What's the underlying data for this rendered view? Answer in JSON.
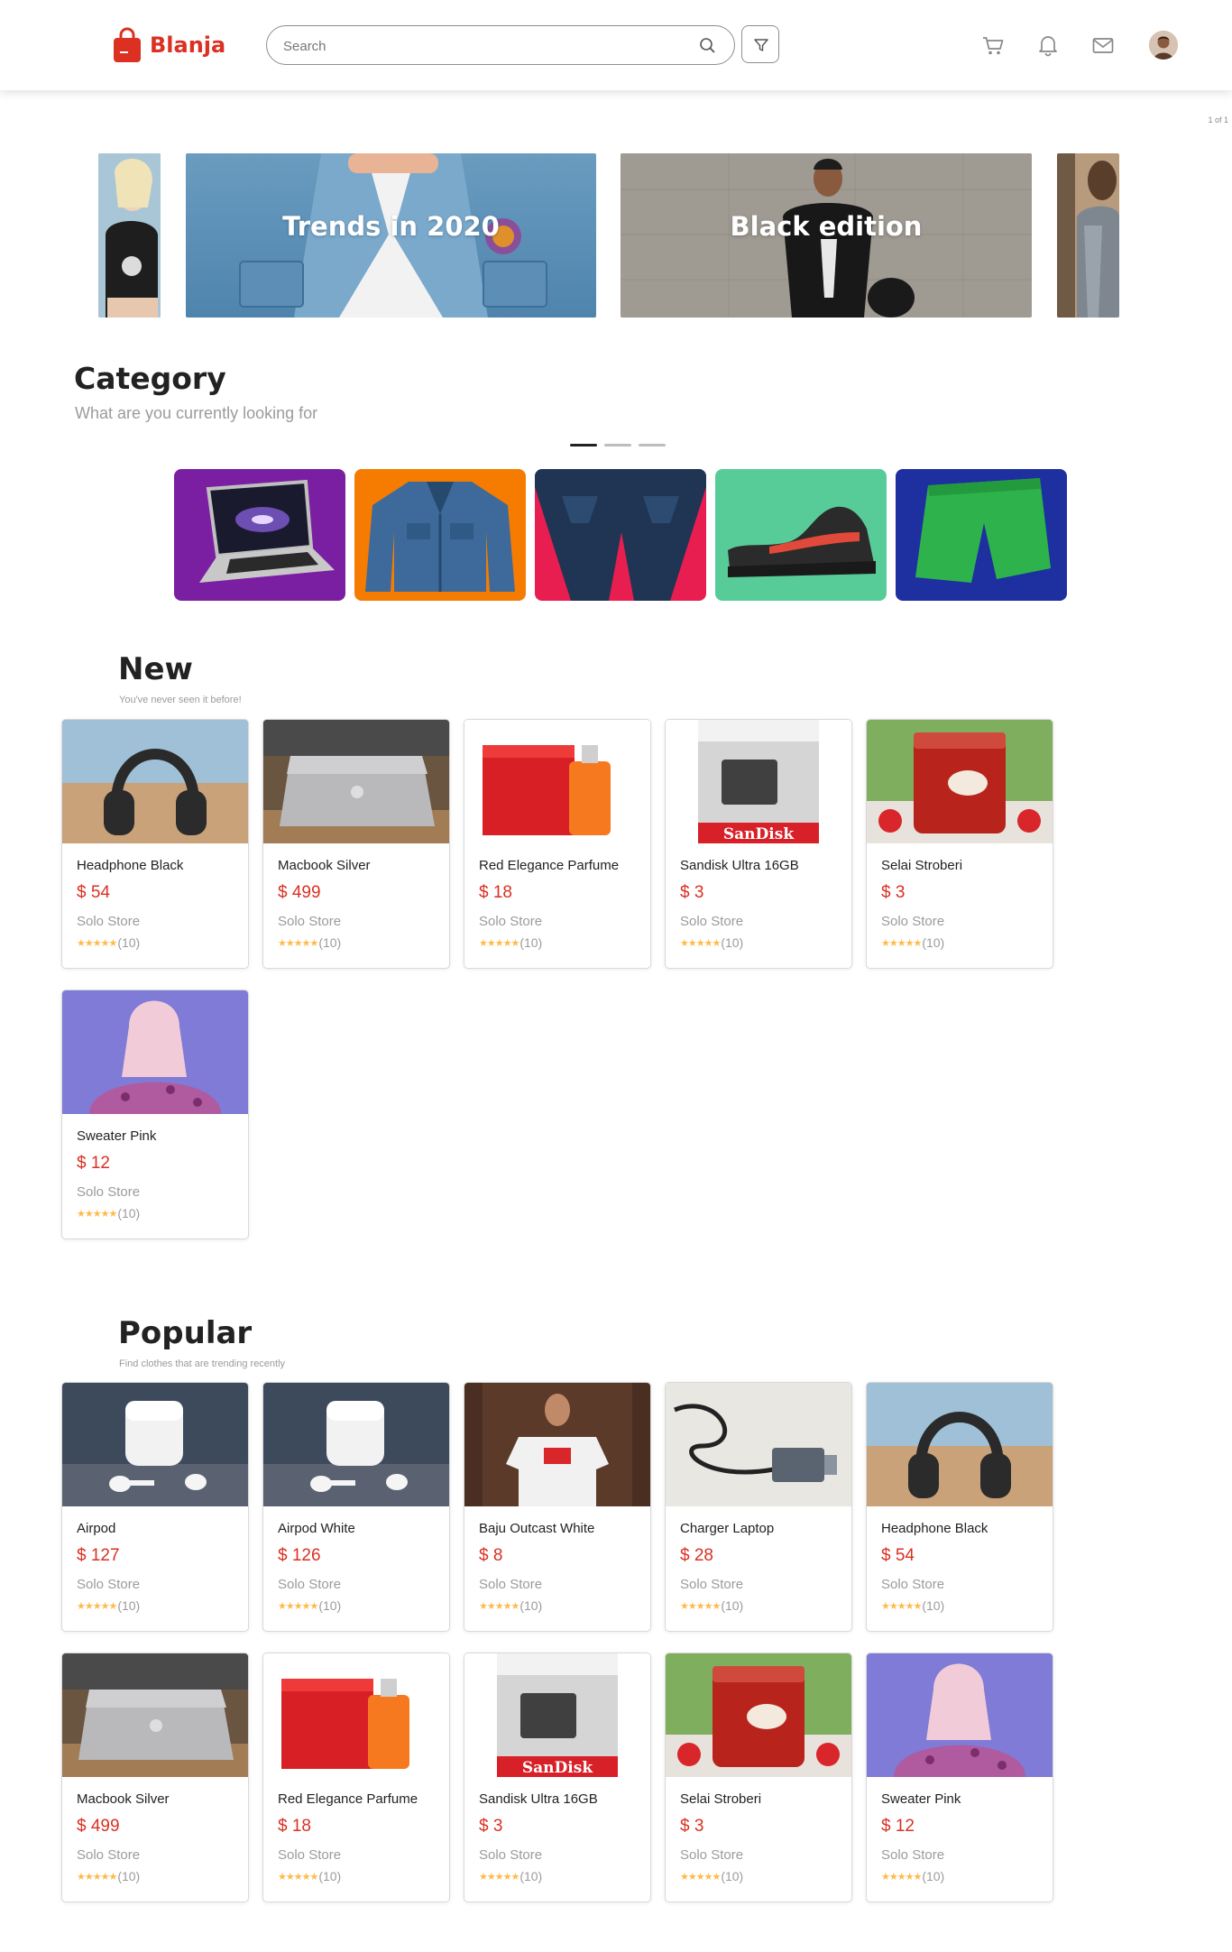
{
  "header": {
    "brand": "Blanja",
    "search_placeholder": "Search"
  },
  "pager": "1 of 1",
  "carousel": {
    "slides": [
      {
        "title": ""
      },
      {
        "title": "Trends in 2020"
      },
      {
        "title": "Black edition"
      },
      {
        "title": ""
      }
    ],
    "dots": 3,
    "active_dot": 0
  },
  "category": {
    "title": "Category",
    "subtitle": "What are you currently looking for",
    "items": [
      {
        "icon": "laptop",
        "color": "#7a1fa2"
      },
      {
        "icon": "jacket",
        "color": "#f57c00"
      },
      {
        "icon": "pants",
        "color": "#e91e50"
      },
      {
        "icon": "shoes",
        "color": "#57cc99"
      },
      {
        "icon": "shorts",
        "color": "#1e2fa0"
      }
    ]
  },
  "new_section": {
    "title": "New",
    "subtitle": "You've never seen it before!",
    "products": [
      {
        "name": "Headphone Black",
        "price": "$ 54",
        "store": "Solo Store",
        "rating": "(10)",
        "image": "headphone"
      },
      {
        "name": "Macbook Silver",
        "price": "$ 499",
        "store": "Solo Store",
        "rating": "(10)",
        "image": "macbook"
      },
      {
        "name": "Red Elegance Parfume",
        "price": "$ 18",
        "store": "Solo Store",
        "rating": "(10)",
        "image": "parfume"
      },
      {
        "name": "Sandisk Ultra 16GB",
        "price": "$ 3",
        "store": "Solo Store",
        "rating": "(10)",
        "image": "sandisk"
      },
      {
        "name": "Selai Stroberi",
        "price": "$ 3",
        "store": "Solo Store",
        "rating": "(10)",
        "image": "jam"
      },
      {
        "name": "Sweater Pink",
        "price": "$ 12",
        "store": "Solo Store",
        "rating": "(10)",
        "image": "sweater"
      }
    ]
  },
  "popular_section": {
    "title": "Popular",
    "subtitle": "Find clothes that are trending recently",
    "products": [
      {
        "name": "Airpod",
        "price": "$ 127",
        "store": "Solo Store",
        "rating": "(10)",
        "image": "airpod"
      },
      {
        "name": "Airpod White",
        "price": "$ 126",
        "store": "Solo Store",
        "rating": "(10)",
        "image": "airpod"
      },
      {
        "name": "Baju Outcast White",
        "price": "$ 8",
        "store": "Solo Store",
        "rating": "(10)",
        "image": "tshirt"
      },
      {
        "name": "Charger Laptop",
        "price": "$ 28",
        "store": "Solo Store",
        "rating": "(10)",
        "image": "charger"
      },
      {
        "name": "Headphone Black",
        "price": "$ 54",
        "store": "Solo Store",
        "rating": "(10)",
        "image": "headphone"
      },
      {
        "name": "Macbook Silver",
        "price": "$ 499",
        "store": "Solo Store",
        "rating": "(10)",
        "image": "macbook"
      },
      {
        "name": "Red Elegance Parfume",
        "price": "$ 18",
        "store": "Solo Store",
        "rating": "(10)",
        "image": "parfume"
      },
      {
        "name": "Sandisk Ultra 16GB",
        "price": "$ 3",
        "store": "Solo Store",
        "rating": "(10)",
        "image": "sandisk"
      },
      {
        "name": "Selai Stroberi",
        "price": "$ 3",
        "store": "Solo Store",
        "rating": "(10)",
        "image": "jam"
      },
      {
        "name": "Sweater Pink",
        "price": "$ 12",
        "store": "Solo Store",
        "rating": "(10)",
        "image": "sweater"
      }
    ]
  },
  "colors": {
    "brand": "#db3022",
    "star": "#ffba49",
    "muted": "#9b9b9b"
  }
}
